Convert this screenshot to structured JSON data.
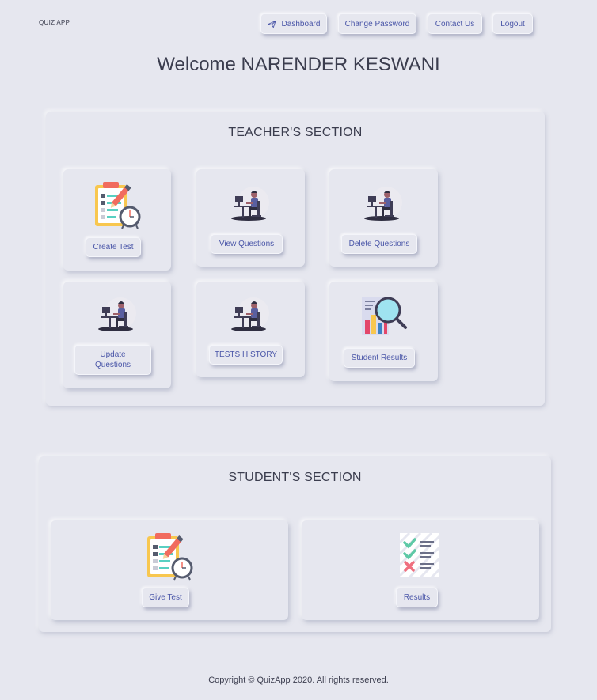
{
  "brand": "QUIZ APP",
  "nav": {
    "dashboard": "Dashboard",
    "change_password": "Change Password",
    "contact_us": "Contact Us",
    "logout": "Logout"
  },
  "welcome": "Welcome NARENDER KESWANI",
  "teacher": {
    "title": "TEACHER'S SECTION",
    "create_test": "Create Test",
    "view_questions": "View Questions",
    "delete_questions": "Delete Questions",
    "update_questions": "Update Questions",
    "tests_history": "TESTS HISTORY",
    "student_results": "Student Results"
  },
  "student": {
    "title": "STUDENT'S SECTION",
    "give_test": "Give Test",
    "results": "Results"
  },
  "footer": "Copyright © QuizApp 2020. All rights reserved."
}
